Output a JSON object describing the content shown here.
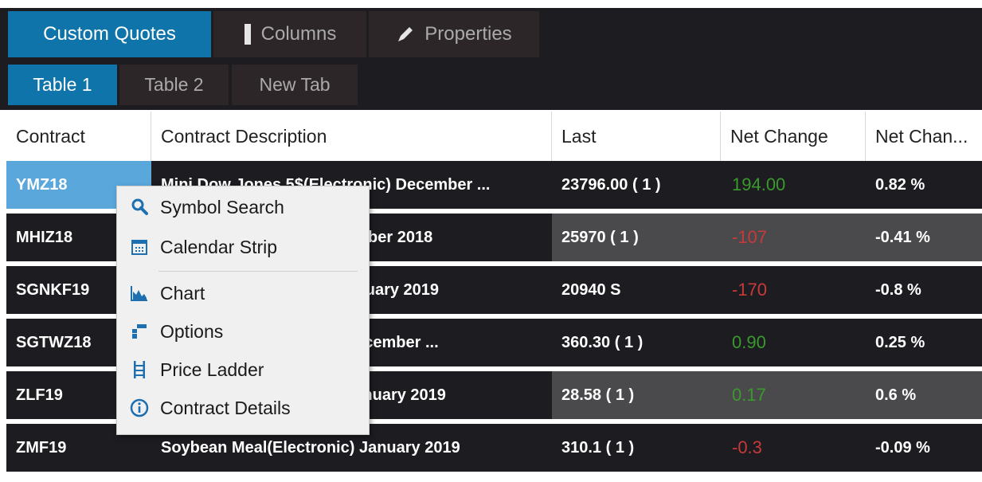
{
  "toolbar": {
    "tabs": [
      {
        "label": "Custom Quotes",
        "icon": "",
        "active": true
      },
      {
        "label": "Columns",
        "icon": "columns-icon",
        "active": false
      },
      {
        "label": "Properties",
        "icon": "pencil-icon",
        "active": false
      }
    ],
    "subtabs": [
      {
        "label": "Table 1",
        "active": true
      },
      {
        "label": "Table 2",
        "active": false
      },
      {
        "label": "New Tab",
        "active": false
      }
    ]
  },
  "table": {
    "columns": [
      "Contract",
      "Contract Description",
      "Last",
      "Net Change",
      "Net Chan..."
    ],
    "rows": [
      {
        "contract": "YMZ18",
        "description": "Mini Dow Jones 5$(Electronic) December ...",
        "last": "23796.00 ( 1 )",
        "net_change": "194.00",
        "net_change_pct": "0.82 %",
        "direction": "up"
      },
      {
        "contract": "MHIZ18",
        "description": "Mini HSI(Electronic) December 2018",
        "last": "25970 ( 1 )",
        "net_change": "-107",
        "net_change_pct": "-0.41 %",
        "direction": "down"
      },
      {
        "contract": "SGNKF19",
        "description": "SGX Nikkei(Electronic) January 2019",
        "last": "20940 S",
        "net_change": "-170",
        "net_change_pct": "-0.8 %",
        "direction": "down"
      },
      {
        "contract": "SGTWZ18",
        "description": "SGX Taiwan(Electronic) December ...",
        "last": "360.30 ( 1 )",
        "net_change": "0.90",
        "net_change_pct": "0.25 %",
        "direction": "up"
      },
      {
        "contract": "ZLF19",
        "description": "Soybean Oil(Electronic) January 2019",
        "last": "28.58 ( 1 )",
        "net_change": "0.17",
        "net_change_pct": "0.6 %",
        "direction": "up"
      },
      {
        "contract": "ZMF19",
        "description": "Soybean Meal(Electronic) January 2019",
        "last": "310.1 ( 1 )",
        "net_change": "-0.3",
        "net_change_pct": "-0.09 %",
        "direction": "down"
      }
    ]
  },
  "context_menu": {
    "items": [
      {
        "label": "Symbol Search",
        "icon": "search-icon"
      },
      {
        "label": "Calendar Strip",
        "icon": "calendar-icon"
      },
      {
        "label": "Chart",
        "icon": "chart-icon"
      },
      {
        "label": "Options",
        "icon": "options-icon"
      },
      {
        "label": "Price Ladder",
        "icon": "ladder-icon"
      },
      {
        "label": "Contract Details",
        "icon": "info-icon"
      }
    ]
  },
  "colors": {
    "accent": "#0e74aa",
    "selected_cell": "#5aa7dc",
    "row_dark": "#1c1c21",
    "row_gray": "#4a4a4c",
    "up": "#3a9a2c",
    "down": "#c83a3a"
  }
}
